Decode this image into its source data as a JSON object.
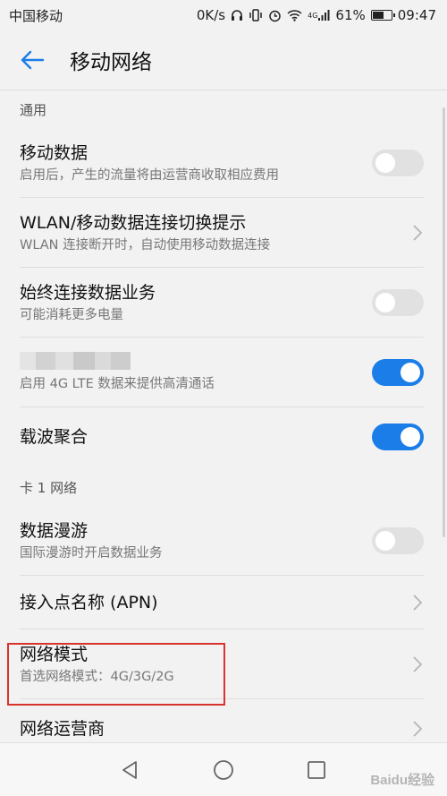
{
  "status": {
    "carrier": "中国移动",
    "speed": "0K/s",
    "network_tag": "4G",
    "battery": "61%",
    "battery_level": 0.61,
    "time": "09:47"
  },
  "header": {
    "title": "移动网络",
    "back_icon": "back-arrow-icon"
  },
  "sections": {
    "general": "通用",
    "sim1": "卡 1 网络"
  },
  "items": {
    "mobile_data": {
      "title": "移动数据",
      "subtitle": "启用后，产生的流量将由运营商收取相应费用",
      "toggle": "off"
    },
    "wlan_switch": {
      "title": "WLAN/移动数据连接切换提示",
      "subtitle": "WLAN 连接断开时，自动使用移动数据连接"
    },
    "always_on": {
      "title": "始终连接数据业务",
      "subtitle": "可能消耗更多电量",
      "toggle": "off"
    },
    "volte": {
      "subtitle": "启用 4G LTE 数据来提供高清通话",
      "toggle": "on"
    },
    "carrier_agg": {
      "title": "载波聚合",
      "toggle": "on"
    },
    "roaming": {
      "title": "数据漫游",
      "subtitle": "国际漫游时开启数据业务",
      "toggle": "off"
    },
    "apn": {
      "title": "接入点名称 (APN)"
    },
    "network_mode": {
      "title": "网络模式",
      "subtitle": "首选网络模式：4G/3G/2G"
    },
    "network_operator": {
      "title": "网络运营商"
    }
  },
  "colors": {
    "accent": "#1a7de8",
    "highlight": "#d9342b"
  },
  "watermark": "Baidu经验"
}
